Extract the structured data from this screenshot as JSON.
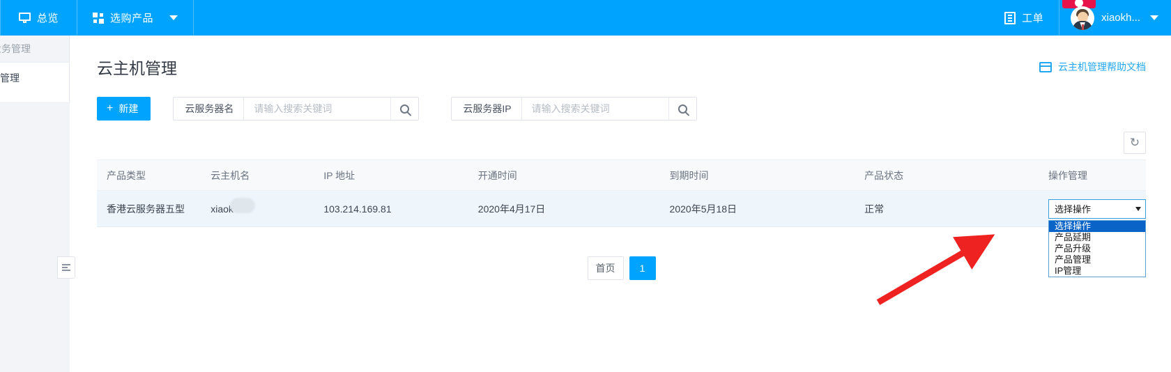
{
  "topbar": {
    "nav": [
      {
        "label": "总览",
        "icon": "monitor-icon"
      },
      {
        "label": "选购产品",
        "icon": "grid-icon",
        "has_caret": true
      }
    ],
    "tickets": {
      "label": "工单",
      "icon": "document-icon"
    },
    "user": {
      "name": "xiaokh...",
      "icon": "avatar-icon"
    },
    "accent_color": "#00a4ff"
  },
  "sidebar": {
    "group_label": "业务管理",
    "items": [
      {
        "label": "机管理"
      }
    ]
  },
  "page": {
    "title": "云主机管理",
    "help_link": "云主机管理帮助文档"
  },
  "toolbar": {
    "new_button": "新建",
    "new_plus": "+",
    "search_name": {
      "label": "云服务器名",
      "value": "",
      "placeholder": "请输入搜索关键词"
    },
    "search_ip": {
      "label": "云服务器IP",
      "value": "",
      "placeholder": "请输入搜索关键词"
    },
    "refresh_icon": "↻"
  },
  "table": {
    "columns": [
      "产品类型",
      "云主机名",
      "IP 地址",
      "开通时间",
      "到期时间",
      "产品状态",
      "操作管理"
    ],
    "rows": [
      {
        "product_type": "香港云服务器五型",
        "host_name": "xiaok",
        "ip": "103.214.169.81",
        "open_time": "2020年4月17日",
        "expire_time": "2020年5月18日",
        "status": "正常"
      }
    ]
  },
  "operation_select": {
    "selected": "选择操作",
    "options": [
      "选择操作",
      "产品延期",
      "产品升级",
      "产品管理",
      "IP管理"
    ],
    "highlight_color": "#0a64c8"
  },
  "pagination": {
    "first_label": "首页",
    "pages": [
      "1"
    ],
    "current": "1"
  },
  "annotation": {
    "arrow_color": "#ef2222"
  }
}
